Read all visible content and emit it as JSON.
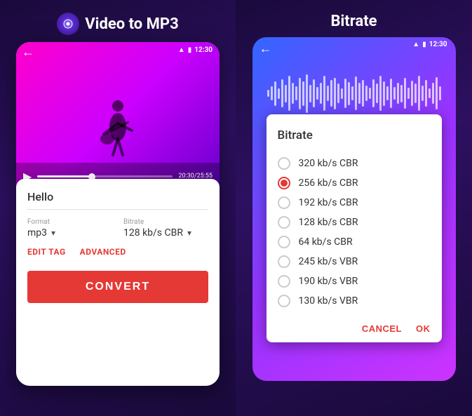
{
  "left": {
    "title": "Video to MP3",
    "title_icon": "music-note",
    "video": {
      "time_current": "20:30",
      "time_total": "25:55",
      "status_time": "12:30"
    },
    "form": {
      "filename": "Hello",
      "format_label": "Format",
      "format_value": "mp3",
      "bitrate_label": "Bitrate",
      "bitrate_value": "128 kb/s CBR",
      "edit_tag_label": "EDIT TAG",
      "advanced_label": "ADVANCED",
      "convert_label": "CONVERT"
    }
  },
  "right": {
    "title": "Bitrate",
    "status_time": "12:30",
    "dialog": {
      "title": "Bitrate",
      "options": [
        {
          "id": "opt1",
          "label": "320 kb/s CBR",
          "selected": false
        },
        {
          "id": "opt2",
          "label": "256 kb/s CBR",
          "selected": true
        },
        {
          "id": "opt3",
          "label": "192 kb/s CBR",
          "selected": false
        },
        {
          "id": "opt4",
          "label": "128 kb/s CBR",
          "selected": false
        },
        {
          "id": "opt5",
          "label": "64   kb/s CBR",
          "selected": false
        },
        {
          "id": "opt6",
          "label": "245 kb/s VBR",
          "selected": false
        },
        {
          "id": "opt7",
          "label": "190 kb/s VBR",
          "selected": false
        },
        {
          "id": "opt8",
          "label": "130 kb/s VBR",
          "selected": false
        }
      ],
      "cancel_label": "CANCEL",
      "ok_label": "OK"
    }
  }
}
